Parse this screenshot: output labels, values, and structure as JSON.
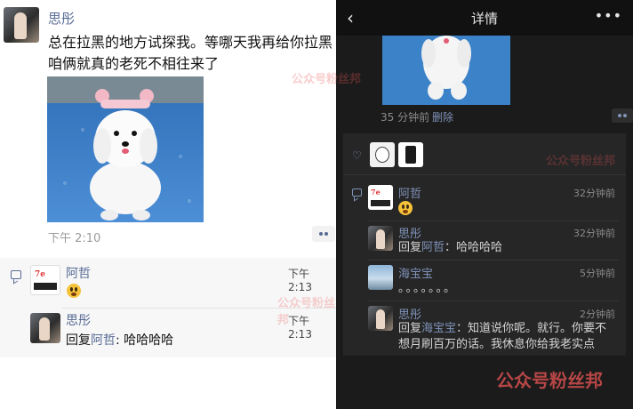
{
  "moment": {
    "author": "思彤",
    "text": "总在拉黑的地方试探我。等哪天我再给你拉黑咱俩就真的老死不相往来了",
    "time": "下午 2:10"
  },
  "left_comments": [
    {
      "name": "阿哲",
      "time": "下午 2:13",
      "emoji": "laughing-emoji"
    },
    {
      "name": "思彤",
      "time": "下午 2:13",
      "reply_prefix": "回复",
      "reply_to": "阿哲",
      "text": ": 哈哈哈哈"
    }
  ],
  "detail": {
    "title": "详情",
    "back_icon": "back-arrow-icon",
    "more_icon": "more-icon",
    "time": "35 分钟前",
    "delete_label": "删除",
    "comments": [
      {
        "name": "阿哲",
        "time": "32分钟前",
        "emoji": "laughing-emoji"
      },
      {
        "name": "思彤",
        "time": "32分钟前",
        "reply_prefix": "回复",
        "reply_to": "阿哲",
        "text": "：哈哈哈哈"
      },
      {
        "name": "海宝宝",
        "time": "5分钟前",
        "text": "。。。。。。。"
      },
      {
        "name": "思彤",
        "time": "2分钟前",
        "reply_prefix": "回复",
        "reply_to": "海宝宝",
        "text": "：知道说你呢。就行。你要不想月刷百万的话。我休息你给我老实点"
      }
    ]
  },
  "watermark": "公众号粉丝邦",
  "colors": {
    "link_light": "#576b95",
    "link_dark": "#7f92b8",
    "dark_bg": "#1b1b1b",
    "comment_dark_bg": "#262626"
  }
}
